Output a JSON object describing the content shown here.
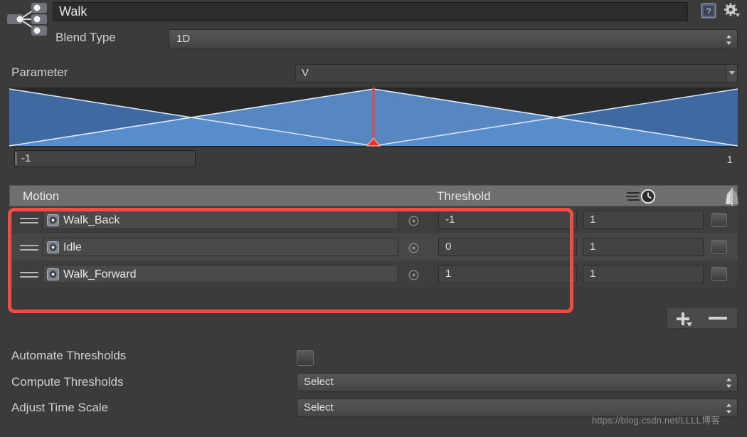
{
  "header": {
    "tree_name": "Walk",
    "blend_type_label": "Blend Type",
    "blend_type_value": "1D",
    "help_icon": "help-book-icon",
    "gear_icon": "gear-dropdown-icon",
    "blendtree_icon": "blend-tree-node-icon"
  },
  "parameter": {
    "label": "Parameter",
    "value": "V",
    "dropdown_icon": "chevron-down-icon"
  },
  "graph": {
    "min_value": "-1",
    "max_value": "1",
    "playhead_position_pct": 50,
    "colors": {
      "background": "#282828",
      "blend_fill": "#4a7fbf",
      "blend_fill_dim": "#3a6296",
      "blend_edge": "#cfe0f2",
      "playhead": "#e8453c"
    }
  },
  "motion_list": {
    "columns": {
      "motion": "Motion",
      "threshold": "Threshold",
      "speed_icon": "speed-clock-icon",
      "mirror_icon": "mirror-humanoid-icon"
    },
    "rows": [
      {
        "drag_handle": "drag-handle-icon",
        "clip_icon": "animation-clip-icon",
        "motion": "Walk_Back",
        "picker_icon": "object-picker-icon",
        "threshold": "-1",
        "speed": "1",
        "mirror": false
      },
      {
        "drag_handle": "drag-handle-icon",
        "clip_icon": "animation-clip-icon",
        "motion": "Idle",
        "picker_icon": "object-picker-icon",
        "threshold": "0",
        "speed": "1",
        "mirror": false
      },
      {
        "drag_handle": "drag-handle-icon",
        "clip_icon": "animation-clip-icon",
        "motion": "Walk_Forward",
        "picker_icon": "object-picker-icon",
        "threshold": "1",
        "speed": "1",
        "mirror": false
      }
    ],
    "highlight_color": "#ff4a42"
  },
  "list_buttons": {
    "add_icon": "plus-dropdown-icon",
    "remove_icon": "minus-icon"
  },
  "properties": {
    "automate_thresholds_label": "Automate Thresholds",
    "automate_thresholds_checked": false,
    "compute_thresholds_label": "Compute Thresholds",
    "compute_thresholds_value": "Select",
    "adjust_time_scale_label": "Adjust Time Scale",
    "adjust_time_scale_value": "Select"
  },
  "watermark": "https://blog.csdn.net/LLLL博客"
}
